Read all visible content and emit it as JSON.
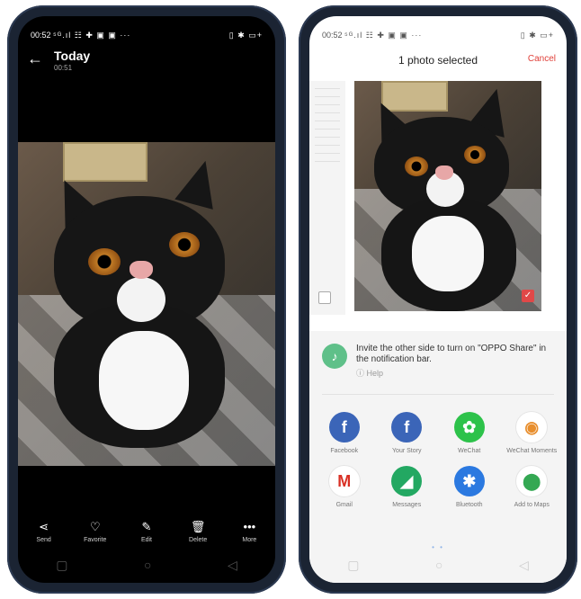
{
  "left_phone": {
    "status": {
      "time": "00:52",
      "signal_icons": "⁵ᴳ.ıl ☷ ✚ ▣ ▣ ···",
      "right_icons": "▯ ✱ ▭+"
    },
    "header": {
      "title": "Today",
      "subtitle": "00:51"
    },
    "actions": [
      {
        "icon": "share-icon",
        "glyph": "⋖",
        "label": "Send"
      },
      {
        "icon": "heart-icon",
        "glyph": "♡",
        "label": "Favorite"
      },
      {
        "icon": "edit-icon",
        "glyph": "✎",
        "label": "Edit"
      },
      {
        "icon": "trash-icon",
        "glyph": "🗑",
        "label": "Delete"
      },
      {
        "icon": "more-icon",
        "glyph": "•••",
        "label": "More"
      }
    ],
    "nav": {
      "recent": "▢",
      "home": "○",
      "back": "◁"
    }
  },
  "right_phone": {
    "status": {
      "time": "00:52",
      "signal_icons": "⁵ᴳ.ıl ☷ ✚ ▣ ▣ ···",
      "right_icons": "▯ ✱ ▭+"
    },
    "header": {
      "title": "1 photo selected",
      "cancel": "Cancel"
    },
    "oppo_share": {
      "message": "Invite the other side to turn on \"OPPO Share\" in the notification bar.",
      "help": "Help"
    },
    "apps": [
      {
        "label": "Facebook",
        "glyph": "f",
        "color": "#3b65b8",
        "icon": "facebook-icon"
      },
      {
        "label": "Your Story",
        "glyph": "f",
        "color": "#3b65b8",
        "icon": "facebook-story-icon"
      },
      {
        "label": "WeChat",
        "glyph": "✿",
        "color": "#2dc24a",
        "icon": "wechat-icon"
      },
      {
        "label": "WeChat Moments",
        "glyph": "◉",
        "color": "#ffffff",
        "icon": "moments-icon"
      },
      {
        "label": "Gmail",
        "glyph": "M",
        "color": "#ffffff",
        "icon": "gmail-icon"
      },
      {
        "label": "Messages",
        "glyph": "◢",
        "color": "#23a862",
        "icon": "messages-icon"
      },
      {
        "label": "Bluetooth",
        "glyph": "✱",
        "color": "#2b79e0",
        "icon": "bluetooth-icon"
      },
      {
        "label": "Add to Maps",
        "glyph": "⬤",
        "color": "#ffffff",
        "icon": "maps-icon"
      }
    ],
    "page_dots": "• •",
    "nav": {
      "recent": "▢",
      "home": "○",
      "back": "◁"
    }
  }
}
